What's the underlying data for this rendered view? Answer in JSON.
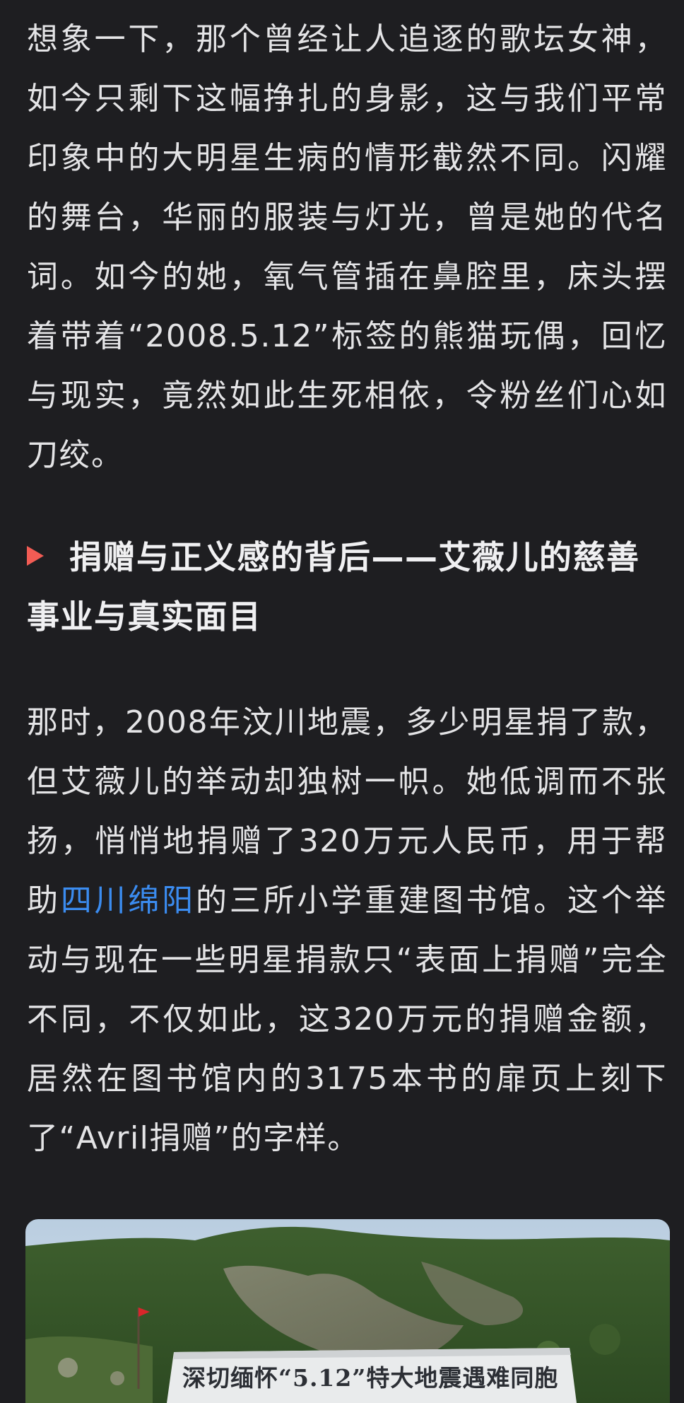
{
  "paragraph_1": {
    "text": "想象一下，那个曾经让人追逐的歌坛女神，如今只剩下这幅挣扎的身影，这与我们平常印象中的大明星生病的情形截然不同。闪耀的舞台，华丽的服装与灯光，曾是她的代名词。如今的她，氧气管插在鼻腔里，床头摆着带着“2008.5.12”标签的熊猫玩偶，回忆与现实，竟然如此生死相依，令粉丝们心如刀绞。"
  },
  "section_heading": {
    "text": "捐赠与正义感的背后——艾薇儿的慈善事业与真实面目"
  },
  "paragraph_2": {
    "before_link": "那时，2008年汶川地震，多少明星捐了款，但艾薇儿的举动却独树一帜。她低调而不张扬，悄悄地捐赠了320万元人民币，用于帮助",
    "link_text": "四川绵阳",
    "after_link": "的三所小学重建图书馆。这个举动与现在一些明星捐款只“表面上捐赠”完全不同，不仅如此，这320万元的捐赠金额，居然在图书馆内的3175本书的扉页上刻下了“Avril捐赠”的字样。"
  },
  "photo": {
    "banner_text": "深切缅怀“5.12”特大地震遇难同胞"
  },
  "colors": {
    "background": "#1e1e21",
    "text": "#e4e4e6",
    "link": "#3b8cf0",
    "heading_marker": "#f25c54"
  }
}
